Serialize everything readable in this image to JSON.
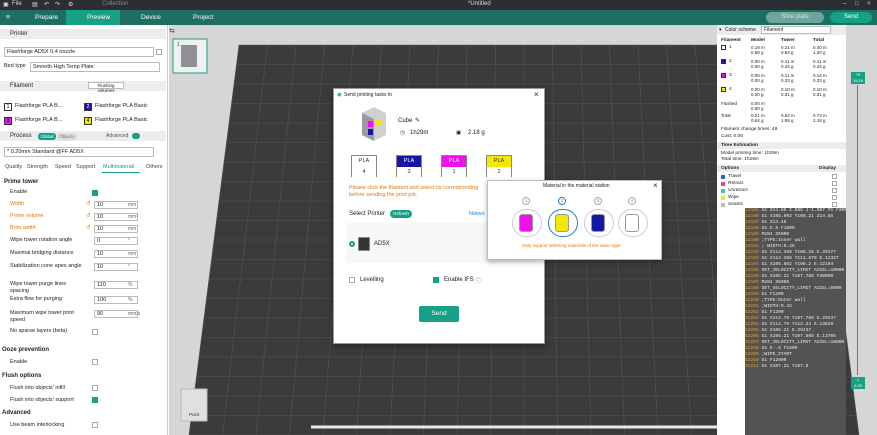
{
  "titlebar": {
    "file": "File",
    "collection": "Collection",
    "title": "*Untitled"
  },
  "nav": {
    "tabs": [
      {
        "label": "Prepare"
      },
      {
        "label": "Preview"
      },
      {
        "label": "Device"
      },
      {
        "label": "Project"
      }
    ],
    "slice_label": "Slice plate",
    "send_label": "Send"
  },
  "left": {
    "printer_header": "Printer",
    "printer_name": "Flashforge AD5X 0.4 nozzle",
    "bed_type_label": "Bed type",
    "bed_type_value": "Smooth High Temp Plate",
    "filament_header": "Filament",
    "flushing_label": "Flushing volumes",
    "filaments": [
      {
        "num": "1",
        "name": "Flashforge PLA B...",
        "color": "#ffffff"
      },
      {
        "num": "2",
        "name": "Flashforge PLA Basic",
        "color": "#1515a8"
      },
      {
        "num": "3",
        "name": "Flashforge PLA B...",
        "color": "#ee11ee"
      },
      {
        "num": "4",
        "name": "Flashforge PLA Basic",
        "color": "#f2e800"
      }
    ],
    "process_header": "Process",
    "global_label": "Global",
    "objects_label": "Objects",
    "advanced_label": "Advanced",
    "process_value": "* 0.20mm Standard @FF AD5X",
    "subtabs": [
      "Quality",
      "Strength",
      "Speed",
      "Support",
      "Multimaterial",
      "Others"
    ],
    "prime_tower_header": "Prime tower",
    "settings": [
      {
        "label": "Enable",
        "value": "",
        "unit": ""
      },
      {
        "label": "Width",
        "value": "10",
        "unit": "mm"
      },
      {
        "label": "Prime volume",
        "value": "10",
        "unit": "mm³"
      },
      {
        "label": "Brim width",
        "value": "10",
        "unit": "mm"
      },
      {
        "label": "Wipe tower rotation angle",
        "value": "0",
        "unit": "°"
      },
      {
        "label": "Maximal bridging distance",
        "value": "10",
        "unit": "mm"
      },
      {
        "label": "Stabilization cone apex angle",
        "value": "10",
        "unit": "°"
      },
      {
        "label": "Wipe tower purge lines spacing",
        "value": "110",
        "unit": "%"
      },
      {
        "label": "Extra flow for purging",
        "value": "100",
        "unit": "%"
      },
      {
        "label": "Maximum wipe tower print speed",
        "value": "90",
        "unit": "mm/s"
      },
      {
        "label": "No sparse layers (beta)",
        "value": "",
        "unit": ""
      }
    ],
    "ooze_header": "Ooze prevention",
    "ooze_enable": "Enable",
    "flush_header": "Flush options",
    "flush_infill": "Flush into objects' infill",
    "flush_support": "Flush into objects' support",
    "advanced_header": "Advanced",
    "beam_label": "Use beam interlocking"
  },
  "viewport": {
    "plate_label": "Point",
    "layer_top_a": "76",
    "layer_top_b": "15.26",
    "layer_bot_a": "1",
    "layer_bot_b": "0.25"
  },
  "right": {
    "color_scheme": "Color scheme",
    "scheme_value": "Filament",
    "cols": [
      "Filament",
      "Model",
      "Tower",
      "Total"
    ],
    "rows": [
      {
        "id": "1",
        "color": "#ffffff",
        "model": [
          "0.19 m",
          "0.58 g"
        ],
        "tower": [
          "0.21 m",
          "0.62 g"
        ],
        "total": [
          "0.40 m",
          "1.20 g"
        ]
      },
      {
        "id": "2",
        "color": "#1515a8",
        "model": [
          "0.00 m",
          "0.00 g"
        ],
        "tower": [
          "0.11 m",
          "0.34 g"
        ],
        "total": [
          "0.11 m",
          "0.34 g"
        ]
      },
      {
        "id": "3",
        "color": "#ee11ee",
        "model": [
          "0.00 m",
          "0.00 g"
        ],
        "tower": [
          "0.11 m",
          "0.33 g"
        ],
        "total": [
          "0.12 m",
          "0.33 g"
        ]
      },
      {
        "id": "4",
        "color": "#f2e800",
        "model": [
          "0.00 m",
          "0.00 g"
        ],
        "tower": [
          "0.10 m",
          "0.31 g"
        ],
        "total": [
          "0.10 m",
          "0.31 g"
        ]
      }
    ],
    "flushed": {
      "label": "Flushed",
      "v": [
        "0.00 m",
        "0.00 g"
      ]
    },
    "total": {
      "label": "Total",
      "model": [
        "0.21 m",
        "0.64 g"
      ],
      "tower": [
        "0.53 m",
        "1.59 g"
      ],
      "total": [
        "0.73 m",
        "2.18 g"
      ]
    },
    "filament_changes": "Filament change times: 48",
    "cost": "Cost: 0.06",
    "time_header": "Time Estimation",
    "model_time": "Model printing time: 1h29m",
    "total_time": "Total time: 1h29m",
    "options_label": "Options",
    "display_label": "Display",
    "options": [
      {
        "label": "Travel",
        "color": "#3a5ad9"
      },
      {
        "label": "Retract",
        "color": "#d94aa8"
      },
      {
        "label": "Unretract",
        "color": "#3ac7a5"
      },
      {
        "label": "Wipe",
        "color": "#e5e34a"
      },
      {
        "label": "Seams",
        "color": "#bbbbbb"
      }
    ]
  },
  "gcode": [
    {
      "n": "12185",
      "t": "G1 Z14.85 I.565 J-1.067 P1 F30000"
    },
    {
      "n": "12186",
      "t": "G1 X105.602 Y108.21 Z14.85"
    },
    {
      "n": "12187",
      "t": "G1 Z14.45"
    },
    {
      "n": "12188",
      "t": "G1 E.8 F1800"
    },
    {
      "n": "12189",
      "t": "M204 S5000"
    },
    {
      "n": "12190",
      "t": ";TYPE:Inner wall"
    },
    {
      "n": "12191",
      "t": "; WIDTH:0.45"
    },
    {
      "n": "12192",
      "t": "G1 X114.398 Y108.16 E.29177"
    },
    {
      "n": "12193",
      "t": "G1 X114.398 Y111.876 E.12327"
    },
    {
      "n": "12194",
      "t": "G1 X105.602 Y108.2 E.12194"
    },
    {
      "n": "12195",
      "t": "SET_VELOCITY_LIMIT ACCEL=10000"
    },
    {
      "n": "12196",
      "t": "G1 X105.21 Y107.768 F30000"
    },
    {
      "n": "12197",
      "t": "M204 S5000"
    },
    {
      "n": "12198",
      "t": "SET_VELOCITY_LIMIT ACCEL=5000"
    },
    {
      "n": "12199",
      "t": "G1 F1200"
    },
    {
      "n": "12200",
      "t": ";TYPE:Outer wall"
    },
    {
      "n": "12201",
      "t": ";WIDTH:0.42"
    },
    {
      "n": "12202",
      "t": "G1 F1200"
    },
    {
      "n": "12203",
      "t": "G1 X114.79 Y107.768 E.29437"
    },
    {
      "n": "12204",
      "t": "G1 X114.79 Y112.24 E.13828"
    },
    {
      "n": "12205",
      "t": "G1 X105.21 E.29437"
    },
    {
      "n": "12206",
      "t": "G1 X105.21 Y107.808 E.13705"
    },
    {
      "n": "12207",
      "t": "SET_VELOCITY_LIMIT ACCEL=10000"
    },
    {
      "n": "12208",
      "t": "G1 E-.8 F1800"
    },
    {
      "n": "12209",
      "t": ";WIPE_START"
    },
    {
      "n": "12210",
      "t": "G1 F12000"
    },
    {
      "n": "12211",
      "t": "G1 X107.21 Y107.8"
    }
  ],
  "send_dialog": {
    "title": "Send printing tasks to",
    "close": "×",
    "model_name": "Cube",
    "time": "1h29m",
    "weight": "2.18 g",
    "slots": [
      {
        "type": "PLA",
        "num": "4",
        "color": "#ffffff",
        "text": "#333"
      },
      {
        "type": "PLA",
        "num": "3",
        "color": "#1515a8",
        "text": "#fff"
      },
      {
        "type": "PLA",
        "num": "1",
        "color": "#ee11ee",
        "text": "#fff"
      },
      {
        "type": "PLA",
        "num": "2",
        "color": "#f2e800",
        "text": "#333"
      }
    ],
    "warning": "Please click the filament and select its corresponding... before sending the print job.",
    "warning_a": "Please click the filament and select its corresponding",
    "warning_b": "before sending the print job.",
    "select_printer": "Select Printer",
    "refresh": "Refresh",
    "network": "Netwo",
    "printer": "AD5X",
    "leveling": "Levelling",
    "ifs": "Enable IFS",
    "send": "Send"
  },
  "material_dialog": {
    "title": "Material in the material station",
    "close": "×",
    "slots": [
      "1",
      "2",
      "3",
      "4"
    ],
    "slot_colors": [
      "#ee11ee",
      "#f2e800",
      "#1515a8",
      "#ffffff"
    ],
    "note": "Only support selecting materials of the same type"
  }
}
